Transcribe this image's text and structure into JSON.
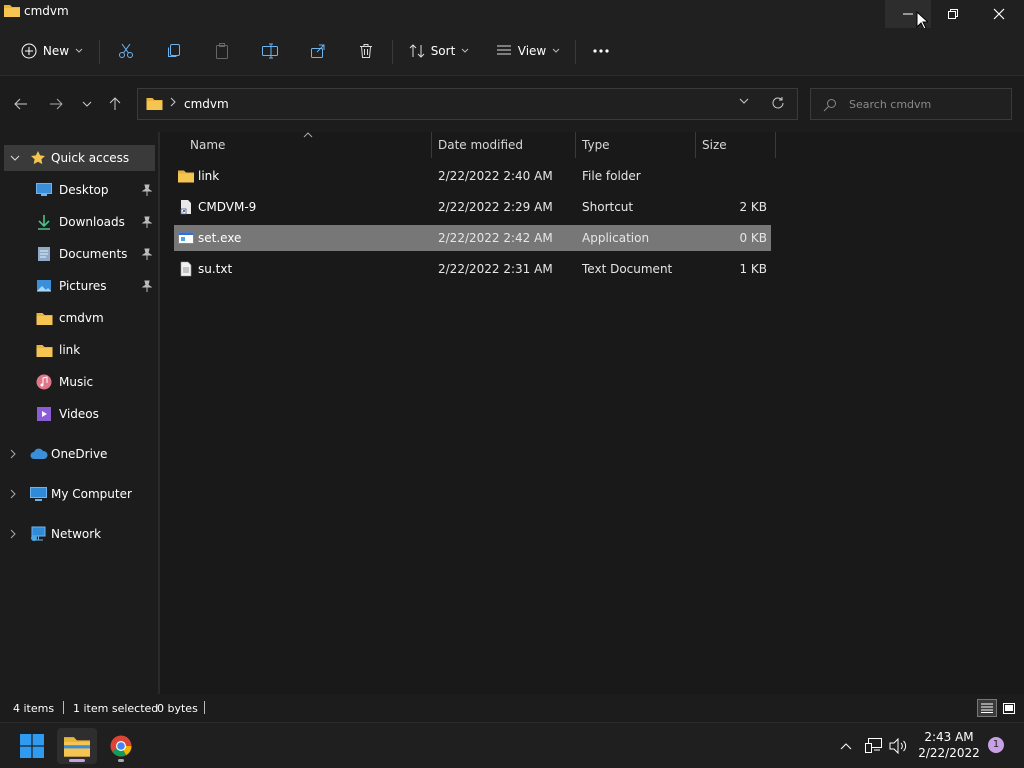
{
  "window": {
    "title": "cmdvm",
    "accent": "#f5c451"
  },
  "command_bar": {
    "new_label": "New",
    "sort_label": "Sort",
    "view_label": "View"
  },
  "address_bar": {
    "path": "cmdvm",
    "search_placeholder": "Search cmdvm"
  },
  "sidebar": {
    "quick_access": "Quick access",
    "items": [
      {
        "label": "Desktop",
        "icon": "desktop-icon",
        "pinned": true
      },
      {
        "label": "Downloads",
        "icon": "download-icon",
        "pinned": true
      },
      {
        "label": "Documents",
        "icon": "documents-icon",
        "pinned": true
      },
      {
        "label": "Pictures",
        "icon": "pictures-icon",
        "pinned": true
      },
      {
        "label": "cmdvm",
        "icon": "folder-icon",
        "pinned": false
      },
      {
        "label": "link",
        "icon": "folder-icon",
        "pinned": false
      },
      {
        "label": "Music",
        "icon": "music-icon",
        "pinned": false
      },
      {
        "label": "Videos",
        "icon": "videos-icon",
        "pinned": false
      }
    ],
    "onedrive": "OneDrive",
    "my_computer": "My Computer",
    "network": "Network"
  },
  "file_list": {
    "columns": {
      "name": "Name",
      "date": "Date modified",
      "type": "Type",
      "size": "Size"
    },
    "rows": [
      {
        "name": "link",
        "date": "2/22/2022 2:40 AM",
        "type": "File folder",
        "size": "",
        "icon": "folder-icon",
        "selected": false
      },
      {
        "name": "CMDVM-9",
        "date": "2/22/2022 2:29 AM",
        "type": "Shortcut",
        "size": "2 KB",
        "icon": "shortcut-icon",
        "selected": false
      },
      {
        "name": "set.exe",
        "date": "2/22/2022 2:42 AM",
        "type": "Application",
        "size": "0 KB",
        "icon": "application-icon",
        "selected": true
      },
      {
        "name": "su.txt",
        "date": "2/22/2022 2:31 AM",
        "type": "Text Document",
        "size": "1 KB",
        "icon": "text-file-icon",
        "selected": false
      }
    ]
  },
  "status_bar": {
    "item_count": "4 items",
    "selection": "1 item selected",
    "selection_size": "0 bytes"
  },
  "taskbar": {
    "time": "2:43 AM",
    "date": "2/22/2022",
    "notification_count": "1"
  }
}
